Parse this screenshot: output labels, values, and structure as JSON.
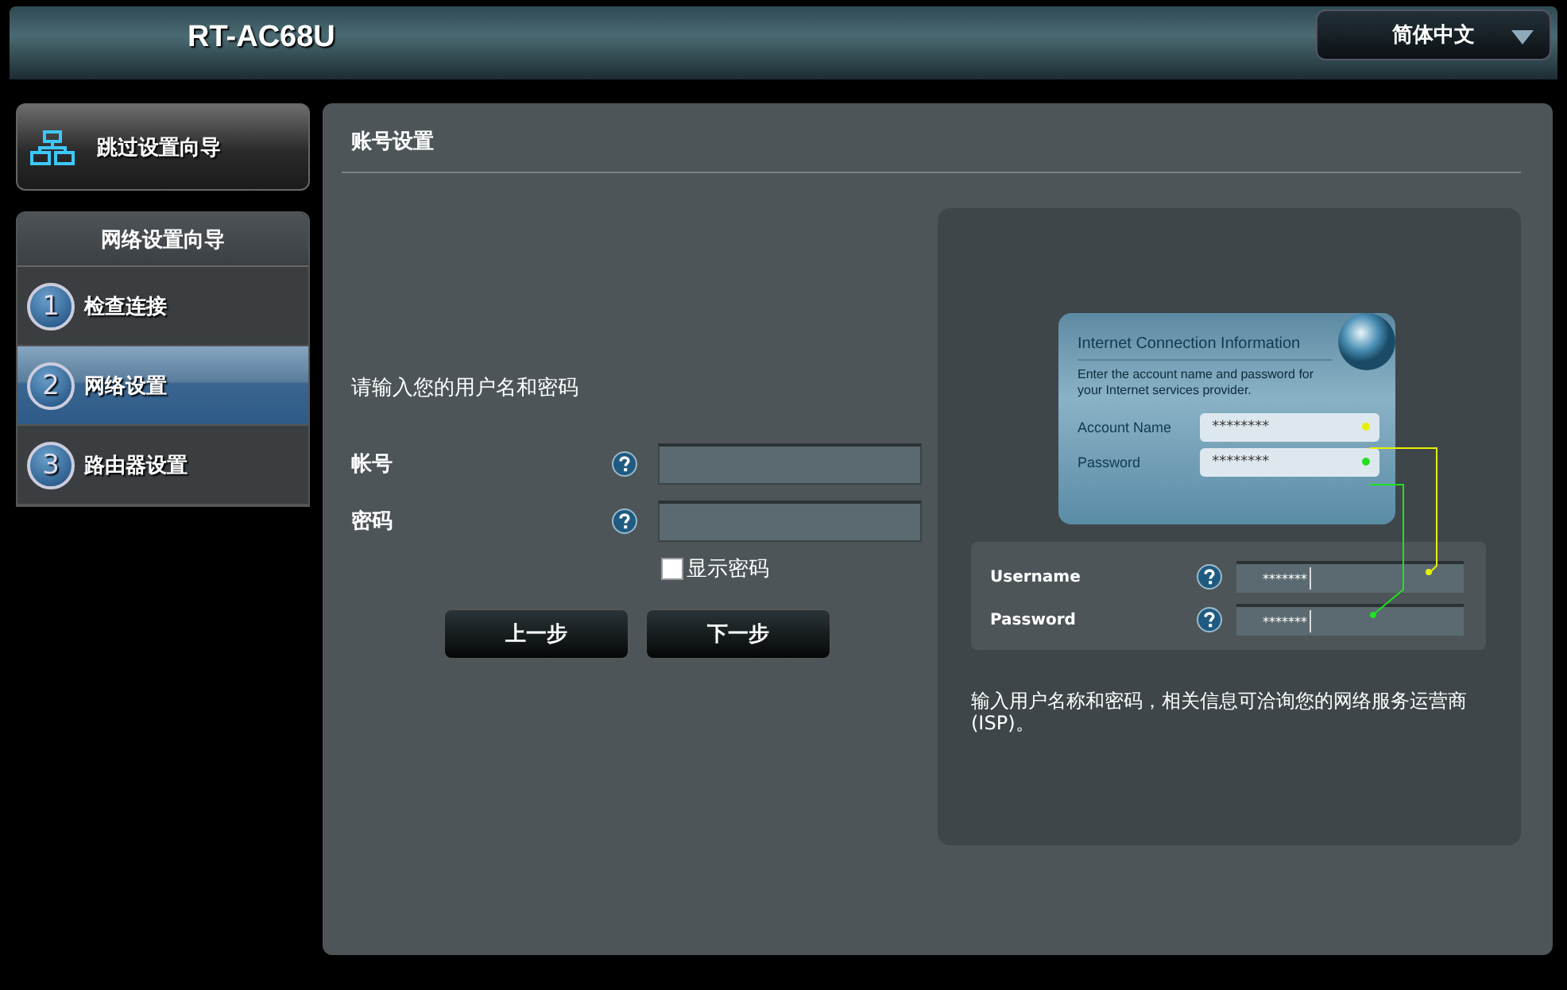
{
  "header": {
    "title": "RT-AC68U"
  },
  "language_select": {
    "value": "简体中文"
  },
  "sidebar": {
    "skip_button": {
      "label": "跳过设置向导"
    },
    "wizard": {
      "title": "网络设置向导",
      "steps": [
        {
          "number": "1",
          "label": "检查连接",
          "selected": false
        },
        {
          "number": "2",
          "label": "网络设置",
          "selected": true
        },
        {
          "number": "3",
          "label": "路由器设置",
          "selected": false
        }
      ]
    }
  },
  "main": {
    "title": "账号设置",
    "prompt": "请输入您的用户名和密码",
    "fields": [
      {
        "label": "帐号"
      },
      {
        "label": "密码"
      }
    ],
    "show_password": {
      "label": "显示密码",
      "checked": false
    },
    "buttons": [
      "上一步",
      "下一步"
    ],
    "illustration": {
      "card": {
        "title": "Internet Connection Information",
        "description": "Enter the account name and password for your Internet services provider.",
        "fields": [
          {
            "label": "Account Name",
            "value": "********",
            "color": "#e8f000"
          },
          {
            "label": "Password",
            "value": "********",
            "color": "#20e020"
          }
        ]
      },
      "form": {
        "fields": [
          {
            "label": "Username",
            "value": "*******"
          },
          {
            "label": "Password",
            "value": "*******"
          }
        ]
      },
      "note": "输入用户名称和密码，相关信息可洽询您的网络服务运营商 (ISP)。"
    }
  }
}
